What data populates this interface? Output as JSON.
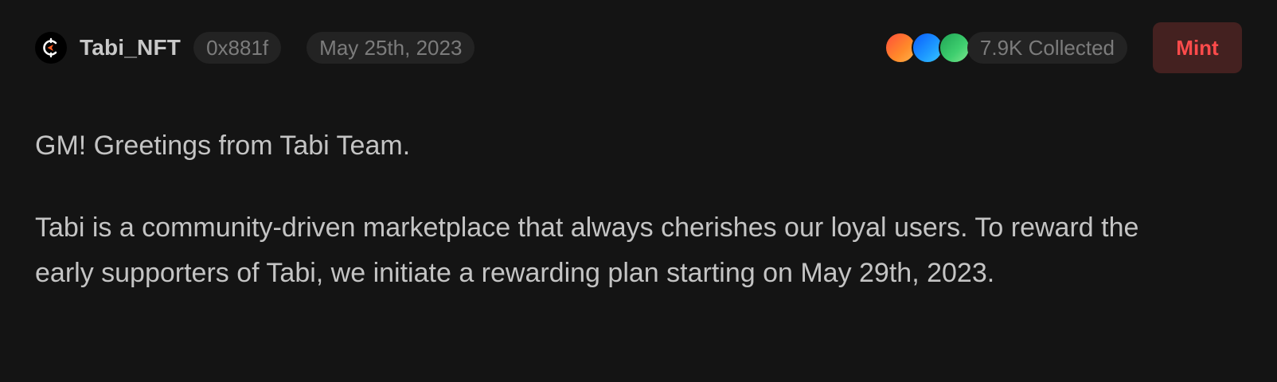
{
  "header": {
    "author": {
      "name": "Tabi_NFT",
      "avatar_icon": "tabi-logo-icon"
    },
    "address": "0x881f",
    "date": "May 25th, 2023",
    "collectors": {
      "avatar_colors": [
        "#ff6a33",
        "#1e9bff",
        "#3fcf6f"
      ],
      "count_label": "7.9K Collected"
    },
    "mint_label": "Mint"
  },
  "post": {
    "greeting": "GM! Greetings from Tabi Team.",
    "body": "Tabi is a community-driven marketplace that always cherishes our loyal users. To reward the early supporters of Tabi, we initiate a rewarding plan starting on May 29th, 2023."
  },
  "colors": {
    "background": "#141414",
    "pill_background": "#232323",
    "mint_background": "#442120",
    "mint_text": "#ff4b4b",
    "logo_accent": "#ff5a1f"
  }
}
